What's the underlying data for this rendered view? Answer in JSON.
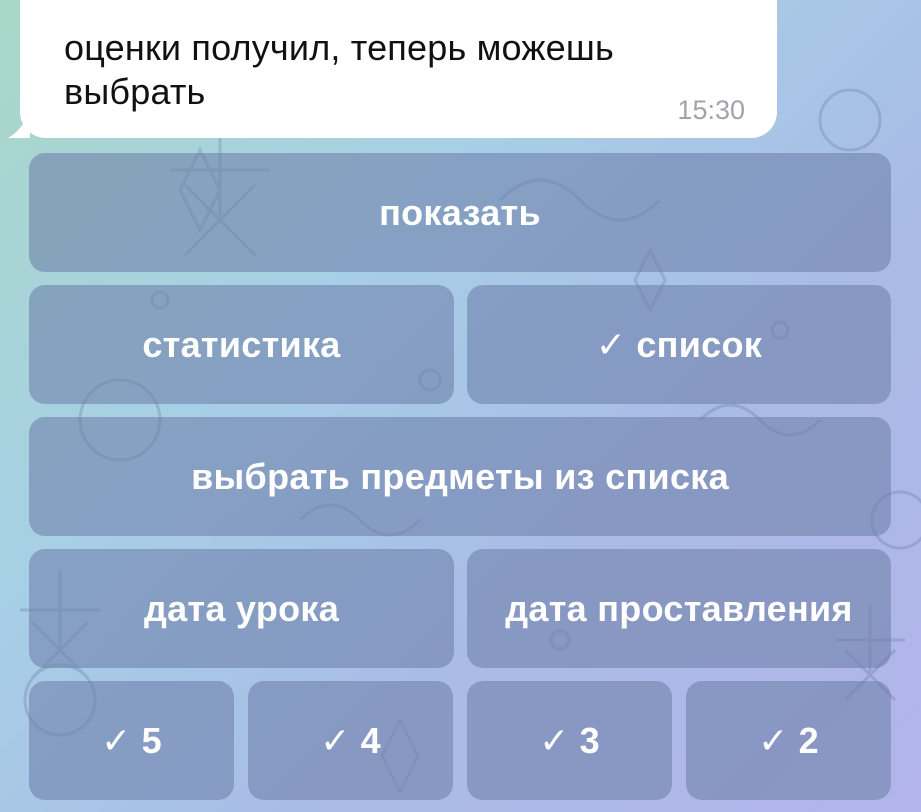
{
  "message": {
    "text": "оценки получил, теперь можешь выбрать",
    "time": "15:30"
  },
  "keyboard": {
    "row1": {
      "show_label": "показать"
    },
    "row2": {
      "stats_label": "статистика",
      "list_label": "список",
      "list_checked": true
    },
    "row3": {
      "choose_subjects_label": "выбрать предметы из списка"
    },
    "row4": {
      "lesson_date_label": "дата урока",
      "set_date_label": "дата проставления"
    },
    "row5": {
      "check_mark": "✓",
      "grades": [
        "5",
        "4",
        "3",
        "2"
      ]
    }
  },
  "colors": {
    "bubble": "#ffffff",
    "button_bg": "rgba(110,128,168,0.58)",
    "button_text": "#ffffff",
    "time_text": "#a0a4aa"
  }
}
